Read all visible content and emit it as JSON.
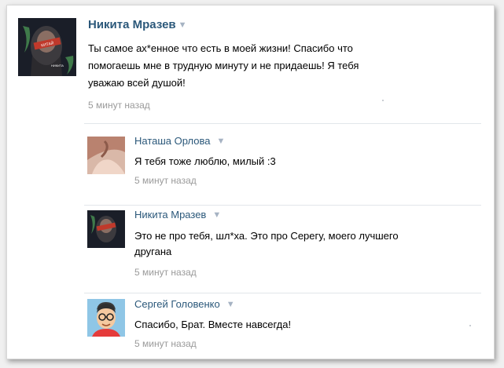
{
  "post": {
    "author": "Никита Мразев",
    "text_lines": [
      "Ты самое ах*енное что есть в моей жизни! Спасибо что",
      "помогаешь мне в трудную минуту и не придаешь! Я тебя",
      "уважаю всей душой!"
    ],
    "time": "5 минут назад",
    "avatar_caption": [
      "НИКИТА",
      "КИТАЙ"
    ]
  },
  "comments": [
    {
      "author": "Наташа Орлова",
      "text_lines": [
        "Я тебя тоже люблю, милый :3"
      ],
      "time": "5 минут назад",
      "avatar": "photo"
    },
    {
      "author": "Никита Мразев",
      "text_lines": [
        "Это не про тебя, шл*ха. Это про Серегу, моего лучшего",
        "другана"
      ],
      "time": "5 минут назад",
      "avatar": "nikita"
    },
    {
      "author": "Сергей Головенко",
      "text_lines": [
        "Спасибо, Брат. Вместе навсегда!"
      ],
      "time": "5 минут назад",
      "avatar": "cartoon"
    }
  ],
  "colors": {
    "name": "#2b587a",
    "time": "#9a9a9a",
    "divider": "#e2e6ea"
  },
  "icons": {
    "dropdown": "chevron-down-icon"
  }
}
